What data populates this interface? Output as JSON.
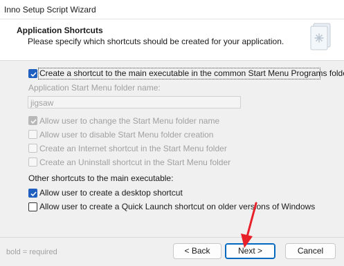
{
  "window": {
    "title": "Inno Setup Script Wizard"
  },
  "header": {
    "title": "Application Shortcuts",
    "subtitle": "Please specify which shortcuts should be created for your application."
  },
  "options": {
    "start_menu_shortcut": {
      "label": "Create a shortcut to the main executable in the common Start Menu Programs folder",
      "checked": true,
      "enabled": true
    },
    "folder_name_label": "Application Start Menu folder name:",
    "folder_name_value": "jigsaw",
    "allow_change_folder": {
      "label": "Allow user to change the Start Menu folder name",
      "checked": true,
      "enabled": false
    },
    "allow_disable_folder": {
      "label": "Allow user to disable Start Menu folder creation",
      "checked": false,
      "enabled": false
    },
    "internet_shortcut": {
      "label": "Create an Internet shortcut in the Start Menu folder",
      "checked": false,
      "enabled": false
    },
    "uninstall_shortcut": {
      "label": "Create an Uninstall shortcut in the Start Menu folder",
      "checked": false,
      "enabled": false
    },
    "other_shortcuts_label": "Other shortcuts to the main executable:",
    "desktop_shortcut": {
      "label": "Allow user to create a desktop shortcut",
      "checked": true,
      "enabled": true
    },
    "quick_launch_shortcut": {
      "label": "Allow user to create a Quick Launch shortcut on older versions of Windows",
      "checked": false,
      "enabled": true
    }
  },
  "footer": {
    "note": "bold = required",
    "back_label": "< Back",
    "next_label": "Next >",
    "cancel_label": "Cancel"
  },
  "colors": {
    "accent": "#1f5fbf",
    "default_button_border": "#0067c0",
    "annotation_arrow": "#e8202a"
  }
}
